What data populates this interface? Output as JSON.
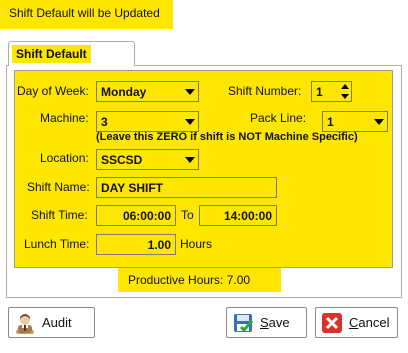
{
  "window": {
    "title": "Shift Default will be Updated"
  },
  "tab": {
    "label": "Shift Default"
  },
  "form": {
    "day_of_week": {
      "label": "Day of Week:",
      "value": "Monday"
    },
    "shift_number": {
      "label": "Shift Number:",
      "value": "1"
    },
    "machine": {
      "label": "Machine:",
      "value": "3"
    },
    "pack_line": {
      "label": "Pack Line:",
      "value": "1"
    },
    "note": "(Leave this ZERO if shift is NOT Machine Specific)",
    "location": {
      "label": "Location:",
      "value": "SSCSD"
    },
    "shift_name": {
      "label": "Shift Name:",
      "value": "DAY SHIFT"
    },
    "shift_time": {
      "label": "Shift Time:",
      "start": "06:00:00",
      "to_label": "To",
      "end": "14:00:00"
    },
    "lunch_time": {
      "label": "Lunch Time:",
      "value": "1.00",
      "unit": "Hours"
    }
  },
  "productive_hours": {
    "label": "Productive Hours:",
    "value": "7.00"
  },
  "buttons": {
    "audit": "Audit",
    "save_prefix": "",
    "save_underlined": "S",
    "save_rest": "ave",
    "cancel_underlined": "C",
    "cancel_rest": "ancel"
  },
  "icons": {
    "audit": "auditor-person-icon",
    "save": "floppy-disk-check-icon",
    "cancel": "red-x-icon"
  },
  "colors": {
    "highlight": "#ffe600",
    "cancel_red": "#d9322b",
    "save_blue": "#3a6fb5"
  }
}
